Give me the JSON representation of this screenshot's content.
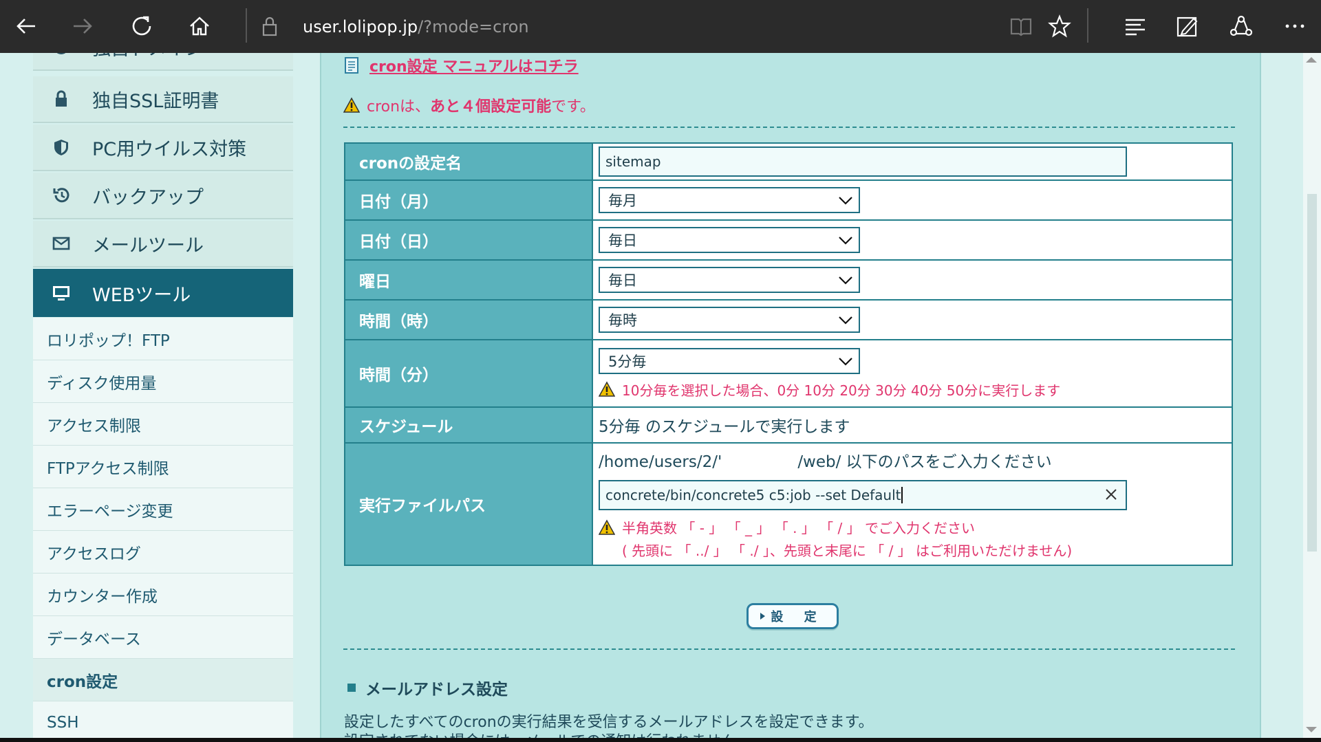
{
  "browser": {
    "url_host": "user.lolipop.jp",
    "url_path": "/?mode=cron"
  },
  "sidebar": {
    "menu": [
      {
        "label": "独自ドメイン",
        "icon": "globe-icon"
      },
      {
        "label": "独自SSL証明書",
        "icon": "lock-icon"
      },
      {
        "label": "PC用ウイルス対策",
        "icon": "shield-icon"
      },
      {
        "label": "バックアップ",
        "icon": "history-icon"
      },
      {
        "label": "メールツール",
        "icon": "mail-icon"
      },
      {
        "label": "WEBツール",
        "icon": "monitor-icon"
      }
    ],
    "sub_items": [
      {
        "label": "ロリポップ！FTP"
      },
      {
        "label": "ディスク使用量"
      },
      {
        "label": "アクセス制限"
      },
      {
        "label": "FTPアクセス制限"
      },
      {
        "label": "エラーページ変更"
      },
      {
        "label": "アクセスログ"
      },
      {
        "label": "カウンター作成"
      },
      {
        "label": "データベース"
      },
      {
        "label": "cron設定"
      },
      {
        "label": "SSH"
      }
    ]
  },
  "main": {
    "manual_link": "cron設定 マニュアルはコチラ",
    "remaining_prefix": "cronは、",
    "remaining_bold": "あと４個設定可能",
    "remaining_suffix": "です。",
    "form": {
      "name_label": "cronの設定名",
      "name_value": "sitemap",
      "month_label": "日付（月）",
      "month_value": "毎月",
      "day_label": "日付（日）",
      "day_value": "毎日",
      "weekday_label": "曜日",
      "weekday_value": "毎日",
      "hour_label": "時間（時）",
      "hour_value": "毎時",
      "minute_label": "時間（分）",
      "minute_value": "5分毎",
      "minute_note": "10分毎を選択した場合、0分 10分 20分 30分 40分 50分に実行します",
      "schedule_label": "スケジュール",
      "schedule_value": "5分毎 のスケジュールで実行します",
      "path_label": "実行ファイルパス",
      "path_prefix": "/home/users/2/'",
      "path_suffix": "/web/ 以下のパスをご入力ください",
      "path_value": "concrete/bin/concrete5 c5:job --set Default",
      "path_note1": "半角英数 「 - 」 「 _ 」 「 . 」 「 / 」 でご入力ください",
      "path_note2": "( 先頭に 「 ../ 」 「 ./ 」、先頭と末尾に 「 / 」 はご利用いただけません)"
    },
    "submit_label": "設 定",
    "mail_section": {
      "title": "メールアドレス設定",
      "line1": "設定したすべてのcronの実行結果を受信するメールアドレスを設定できます。",
      "line2": "設定されてない場合には、メールでの通知は行われません。"
    }
  }
}
